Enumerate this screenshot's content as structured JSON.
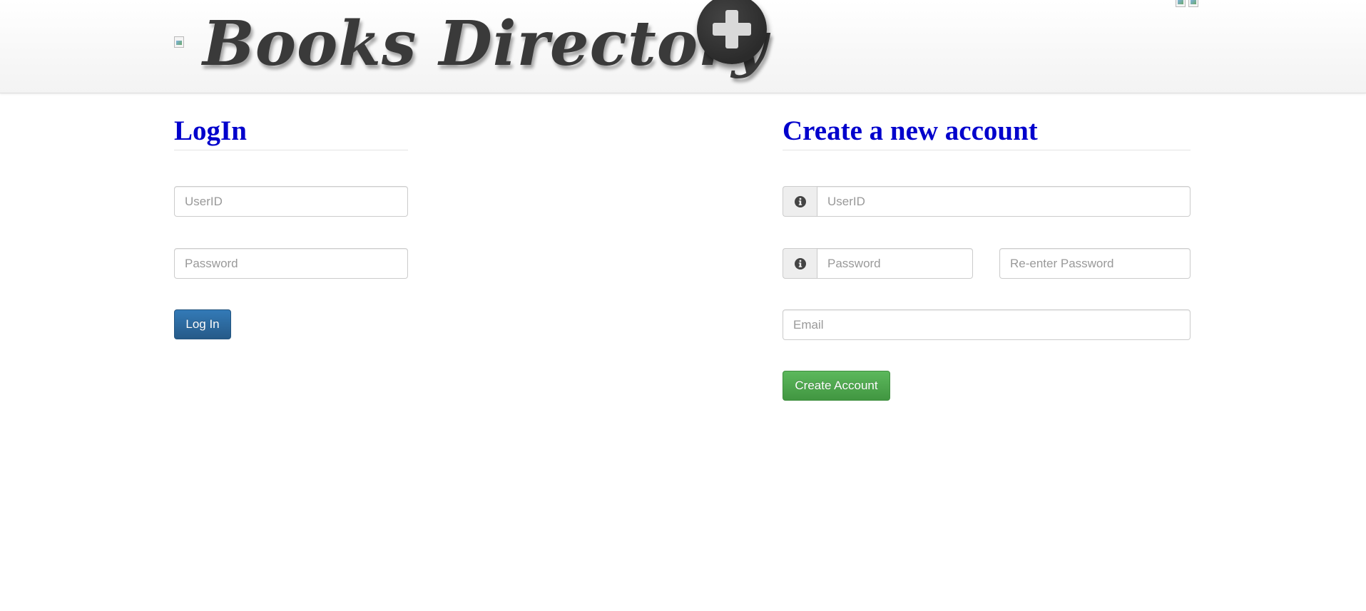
{
  "header": {
    "title": "Books Directory",
    "logo_icon": "plus-icon"
  },
  "login": {
    "title": "LogIn",
    "userid_placeholder": "UserID",
    "password_placeholder": "Password",
    "submit_label": "Log In"
  },
  "register": {
    "title": "Create a new account",
    "userid_placeholder": "UserID",
    "password_placeholder": "Password",
    "reenter_placeholder": "Re-enter Password",
    "email_placeholder": "Email",
    "submit_label": "Create Account",
    "info_icon": "info-icon"
  },
  "colors": {
    "heading": "#0000cc",
    "primary_button": "#337ab7",
    "success_button": "#5cb85c"
  }
}
